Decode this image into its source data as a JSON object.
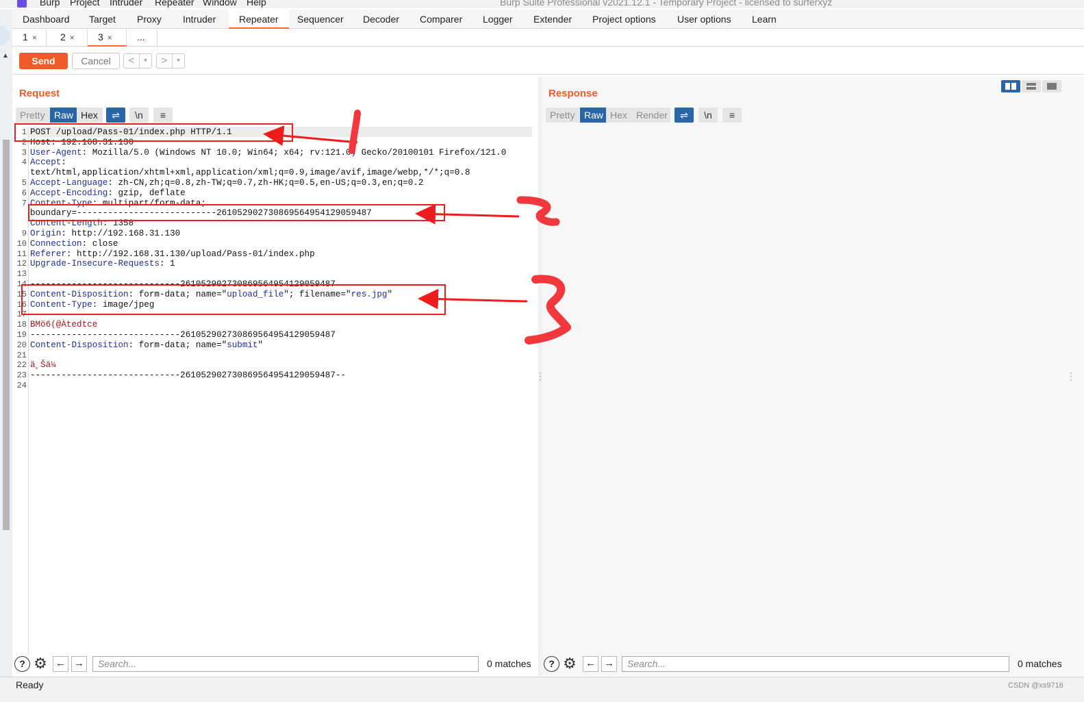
{
  "menubar": {
    "items": [
      "Burp",
      "Project",
      "Intruder",
      "Repeater",
      "Window",
      "Help"
    ],
    "title": "Burp Suite Professional v2021.12.1 - Temporary Project - licensed to surferxyz"
  },
  "main_tabs": [
    "Dashboard",
    "Target",
    "Proxy",
    "Intruder",
    "Repeater",
    "Sequencer",
    "Decoder",
    "Comparer",
    "Logger",
    "Extender",
    "Project options",
    "User options",
    "Learn"
  ],
  "active_main_tab": "Repeater",
  "repeater_tabs": [
    {
      "label": "1",
      "close": "×"
    },
    {
      "label": "2",
      "close": "×"
    },
    {
      "label": "3",
      "close": "×"
    },
    {
      "label": "...",
      "close": ""
    }
  ],
  "toolbar": {
    "send_label": "Send",
    "cancel_label": "Cancel",
    "back_glyph": "<",
    "forward_glyph": ">",
    "dropdown_glyph": "▾"
  },
  "request": {
    "title": "Request",
    "view_tabs": [
      "Pretty",
      "Raw",
      "Hex"
    ],
    "active_view": "Raw",
    "icon_labels": {
      "wrap": "⇌",
      "newline": "\\n",
      "menu": "≡"
    },
    "lines": [
      {
        "n": "1",
        "parts": [
          {
            "t": "POST /upload/Pass-01/index.php HTTP/1.1",
            "c": "plain"
          }
        ]
      },
      {
        "n": "2",
        "parts": [
          {
            "t": "Host: 192.168.31.130",
            "c": "plain"
          }
        ]
      },
      {
        "n": "3",
        "parts": [
          {
            "t": "User-Agent",
            "c": "hk"
          },
          {
            "t": ": Mozilla/5.0 (Windows NT 10.0; Win64; x64; rv:121.0) Gecko/20100101 Firefox/121.0",
            "c": "plain"
          }
        ]
      },
      {
        "n": "4",
        "parts": [
          {
            "t": "Accept",
            "c": "hk"
          },
          {
            "t": ":",
            "c": "plain"
          }
        ]
      },
      {
        "n": "",
        "parts": [
          {
            "t": "text/html,application/xhtml+xml,application/xml;q=0.9,image/avif,image/webp,*/*;q=0.8",
            "c": "plain"
          }
        ]
      },
      {
        "n": "5",
        "parts": [
          {
            "t": "Accept-Language",
            "c": "hk"
          },
          {
            "t": ": zh-CN,zh;q=0.8,zh-TW;q=0.7,zh-HK;q=0.5,en-US;q=0.3,en;q=0.2",
            "c": "plain"
          }
        ]
      },
      {
        "n": "6",
        "parts": [
          {
            "t": "Accept-Encoding",
            "c": "hk"
          },
          {
            "t": ": gzip, deflate",
            "c": "plain"
          }
        ]
      },
      {
        "n": "7",
        "parts": [
          {
            "t": "Content-Type",
            "c": "hk"
          },
          {
            "t": ": multipart/form-data;",
            "c": "plain"
          }
        ]
      },
      {
        "n": "",
        "parts": [
          {
            "t": "boundary=---------------------------261052902730869564954129059487",
            "c": "plain"
          }
        ]
      },
      {
        "n": "",
        "parts": [
          {
            "t": "Content-Length",
            "c": "hk"
          },
          {
            "t": ": 1358",
            "c": "plain"
          }
        ]
      },
      {
        "n": "9",
        "parts": [
          {
            "t": "Origin",
            "c": "hk"
          },
          {
            "t": ": http://192.168.31.130",
            "c": "plain"
          }
        ]
      },
      {
        "n": "10",
        "parts": [
          {
            "t": "Connection",
            "c": "hk"
          },
          {
            "t": ": close",
            "c": "plain"
          }
        ]
      },
      {
        "n": "11",
        "parts": [
          {
            "t": "Referer",
            "c": "hk"
          },
          {
            "t": ": http://192.168.31.130/upload/Pass-01/index.php",
            "c": "plain"
          }
        ]
      },
      {
        "n": "12",
        "parts": [
          {
            "t": "Upgrade-Insecure-Requests",
            "c": "hk"
          },
          {
            "t": ": 1",
            "c": "plain"
          }
        ]
      },
      {
        "n": "13",
        "parts": []
      },
      {
        "n": "14",
        "parts": [
          {
            "t": "-----------------------------261052902730869564954129059487",
            "c": "plain"
          }
        ]
      },
      {
        "n": "15",
        "parts": [
          {
            "t": "Content-Disposition",
            "c": "hk"
          },
          {
            "t": ": form-data; name=\"",
            "c": "plain"
          },
          {
            "t": "upload_file",
            "c": "sv"
          },
          {
            "t": "\"; filename=\"",
            "c": "plain"
          },
          {
            "t": "res.jpg",
            "c": "sv"
          },
          {
            "t": "\"",
            "c": "plain"
          }
        ]
      },
      {
        "n": "16",
        "parts": [
          {
            "t": "Content-Type",
            "c": "hk"
          },
          {
            "t": ": image/jpeg",
            "c": "plain"
          }
        ]
      },
      {
        "n": "17",
        "parts": []
      },
      {
        "n": "18",
        "parts": [
          {
            "t": "BMö6(@Àtedtce",
            "c": "bin"
          }
        ]
      },
      {
        "n": "19",
        "parts": [
          {
            "t": "-----------------------------261052902730869564954129059487",
            "c": "plain"
          }
        ]
      },
      {
        "n": "20",
        "parts": [
          {
            "t": "Content-Disposition",
            "c": "hk"
          },
          {
            "t": ": form-data; name=\"",
            "c": "plain"
          },
          {
            "t": "submit",
            "c": "sv"
          },
          {
            "t": "\"",
            "c": "plain"
          }
        ]
      },
      {
        "n": "21",
        "parts": []
      },
      {
        "n": "22",
        "parts": [
          {
            "t": "ä¸Šä¼ ",
            "c": "bin"
          }
        ]
      },
      {
        "n": "23",
        "parts": [
          {
            "t": "-----------------------------261052902730869564954129059487--",
            "c": "plain"
          }
        ]
      },
      {
        "n": "24",
        "parts": []
      }
    ],
    "search_placeholder": "Search...",
    "matches": "0 matches"
  },
  "response": {
    "title": "Response",
    "view_tabs": [
      "Pretty",
      "Raw",
      "Hex",
      "Render"
    ],
    "active_view": "Raw",
    "icon_labels": {
      "wrap": "⇌",
      "newline": "\\n",
      "menu": "≡"
    },
    "search_placeholder": "Search...",
    "matches": "0 matches"
  },
  "footer_icons": {
    "help": "?",
    "settings": "⚙",
    "prev": "←",
    "next": "→"
  },
  "status": {
    "text": "Ready",
    "watermark": "CSDN @xs9716"
  },
  "annotations": {
    "labels": [
      "1",
      "2",
      "3"
    ],
    "color": "#ee1c1c"
  },
  "colors": {
    "accent": "#f05a28",
    "selected_blue": "#2866a8",
    "header_key": "#1e2f99",
    "binary": "#a4141c"
  }
}
